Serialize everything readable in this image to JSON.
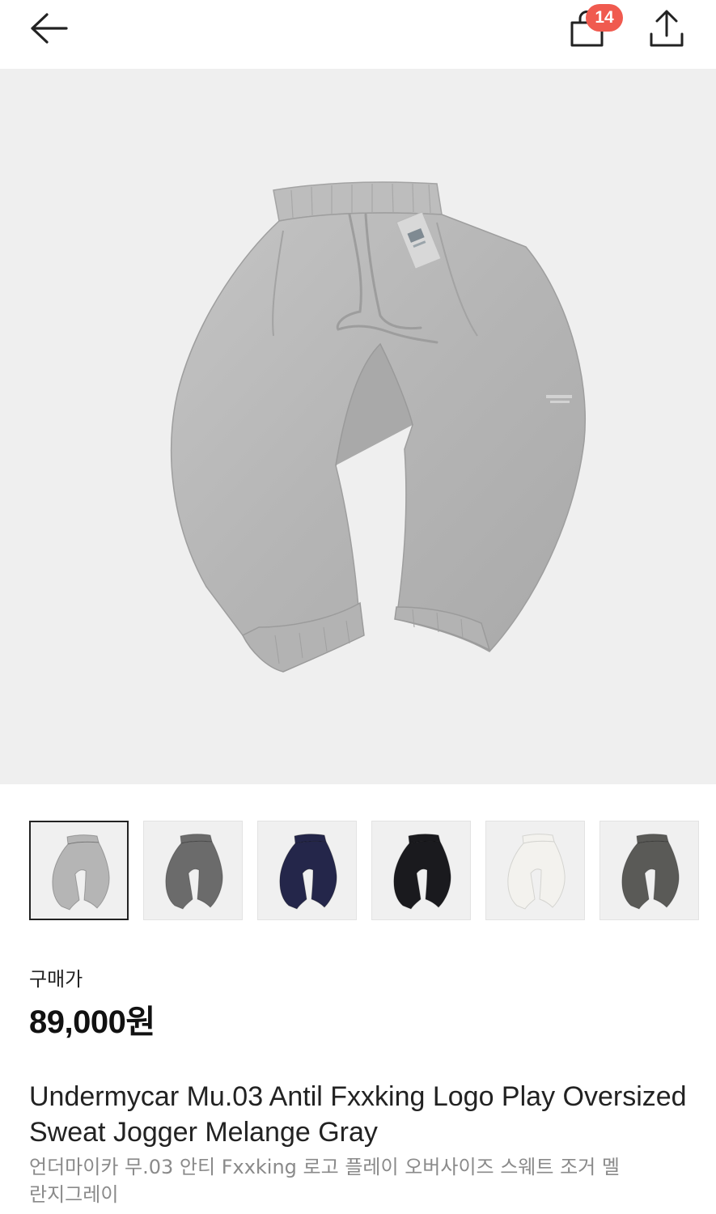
{
  "header": {
    "back_icon": "arrow-left-icon",
    "cart_icon": "shopping-bag-icon",
    "cart_count": "14",
    "share_icon": "share-upload-icon",
    "badge_color": "#f05a4f"
  },
  "product_image": {
    "subject": "gray sweat jogger pants",
    "color": "#b9b9b9"
  },
  "thumbnails": [
    {
      "color_name": "melange gray",
      "color": "#b5b5b5",
      "selected": true
    },
    {
      "color_name": "charcoal",
      "color": "#6b6b6b",
      "selected": false
    },
    {
      "color_name": "navy",
      "color": "#24264a",
      "selected": false
    },
    {
      "color_name": "black",
      "color": "#1a1a1e",
      "selected": false
    },
    {
      "color_name": "white",
      "color": "#f3f2ee",
      "selected": false
    },
    {
      "color_name": "dark gray",
      "color": "#5a5a57",
      "selected": false
    }
  ],
  "pricing": {
    "label": "구매가",
    "price": "89,000원"
  },
  "product": {
    "title_en": "Undermycar Mu.03 Antil Fxxking Logo Play Oversized Sweat Jogger Melange Gray",
    "title_ko": "언더마이카 무.03 안티 Fxxking 로고 플레이 오버사이즈 스웨트 조거 멜란지그레이"
  }
}
